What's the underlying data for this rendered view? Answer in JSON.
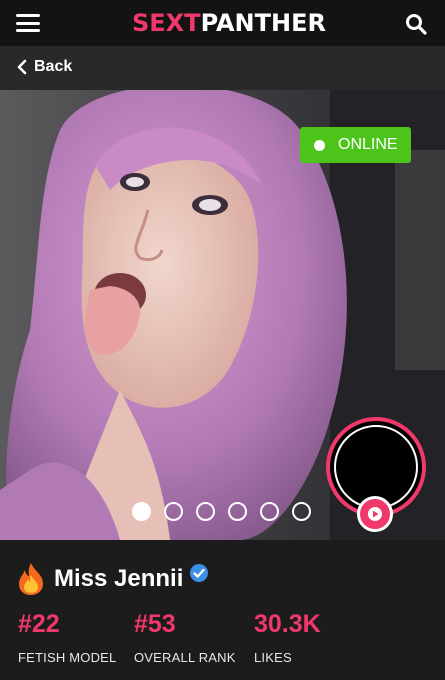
{
  "header": {
    "logo_part1": "SEXT",
    "logo_part2": "PANTHER",
    "menu_icon": "hamburger-menu-icon",
    "search_icon": "search-icon"
  },
  "nav": {
    "back_label": "Back"
  },
  "hero": {
    "status": "ONLINE",
    "status_color": "#4cc41a",
    "carousel": {
      "total": 6,
      "active_index": 1
    }
  },
  "profile": {
    "name": "Miss Jennii",
    "verified": true,
    "stats": [
      {
        "value": "#22",
        "label": "FETISH MODEL"
      },
      {
        "value": "#53",
        "label": "OVERALL RANK"
      },
      {
        "value": "30.3K",
        "label": "LIKES"
      }
    ]
  },
  "colors": {
    "accent": "#f0386b",
    "background": "#1c1c1c",
    "topbar": "#131313"
  }
}
